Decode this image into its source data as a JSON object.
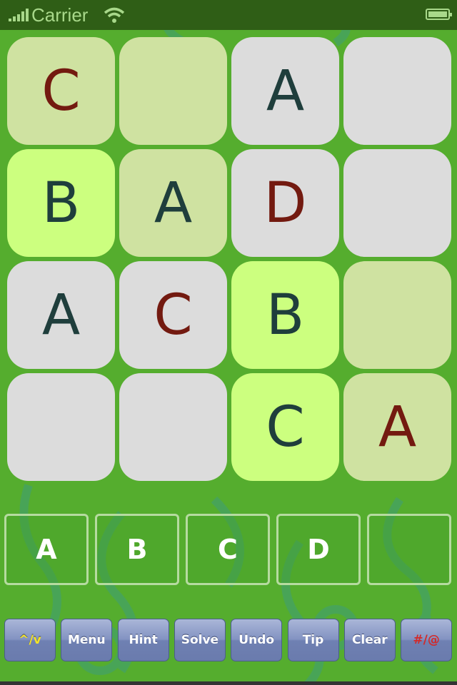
{
  "status_bar": {
    "carrier": "Carrier",
    "icons": [
      "signal-icon",
      "wifi-icon",
      "battery-icon"
    ]
  },
  "grid": {
    "rows": [
      [
        {
          "letter": "C",
          "tone": "pale",
          "kind": "entered"
        },
        {
          "letter": "",
          "tone": "pale",
          "kind": "empty"
        },
        {
          "letter": "A",
          "tone": "grey",
          "kind": "given"
        },
        {
          "letter": "",
          "tone": "grey",
          "kind": "empty"
        }
      ],
      [
        {
          "letter": "B",
          "tone": "lime",
          "kind": "given"
        },
        {
          "letter": "A",
          "tone": "pale",
          "kind": "given"
        },
        {
          "letter": "D",
          "tone": "grey",
          "kind": "entered"
        },
        {
          "letter": "",
          "tone": "grey",
          "kind": "empty"
        }
      ],
      [
        {
          "letter": "A",
          "tone": "grey",
          "kind": "given"
        },
        {
          "letter": "C",
          "tone": "grey",
          "kind": "entered"
        },
        {
          "letter": "B",
          "tone": "lime",
          "kind": "given"
        },
        {
          "letter": "",
          "tone": "pale",
          "kind": "empty"
        }
      ],
      [
        {
          "letter": "",
          "tone": "grey",
          "kind": "empty"
        },
        {
          "letter": "",
          "tone": "grey",
          "kind": "empty"
        },
        {
          "letter": "C",
          "tone": "lime",
          "kind": "given"
        },
        {
          "letter": "A",
          "tone": "pale",
          "kind": "entered"
        }
      ]
    ],
    "colors": {
      "pale": "#cfe2a1",
      "lime": "#ccff7f",
      "grey": "#dcdcdc",
      "given_text": "#1f3e3c",
      "entered_text": "#731a10"
    }
  },
  "input_keys": [
    "A",
    "B",
    "C",
    "D",
    ""
  ],
  "toolbar": {
    "buttons": [
      {
        "label": "^/v",
        "name": "toggle-button",
        "style": "yellow"
      },
      {
        "label": "Menu",
        "name": "menu-button",
        "style": ""
      },
      {
        "label": "Hint",
        "name": "hint-button",
        "style": ""
      },
      {
        "label": "Solve",
        "name": "solve-button",
        "style": ""
      },
      {
        "label": "Undo",
        "name": "undo-button",
        "style": ""
      },
      {
        "label": "Tip",
        "name": "tip-button",
        "style": ""
      },
      {
        "label": "Clear",
        "name": "clear-button",
        "style": ""
      },
      {
        "label": "#/@",
        "name": "symbol-toggle-button",
        "style": "red"
      }
    ]
  },
  "theme": {
    "background": "#55ad2e",
    "status_bar": "#2f5e16"
  }
}
